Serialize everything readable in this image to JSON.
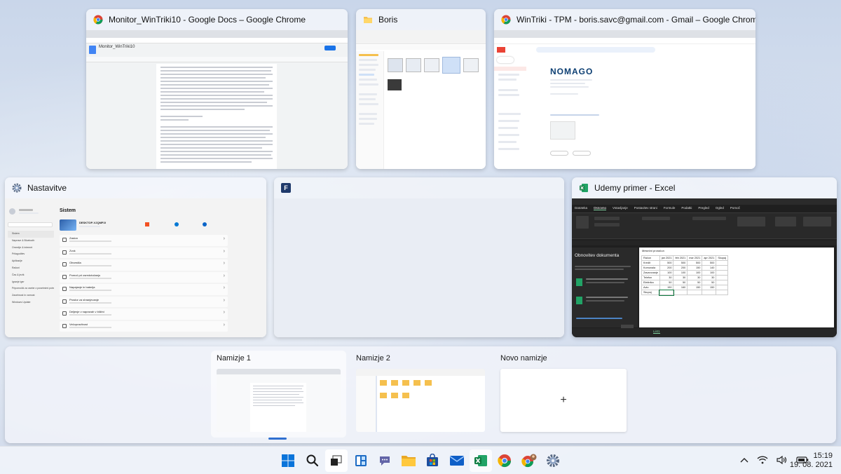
{
  "windows": {
    "docs": {
      "title": "Monitor_WinTriki10 - Google Docs – Google Chrome",
      "doc_title": "Monitor_WinTriki10",
      "icon": "chrome-icon"
    },
    "explorer": {
      "title": "Boris",
      "icon": "folder-icon"
    },
    "gmail": {
      "title": "WinTriki - TPM - boris.savc@gmail.com - Gmail – Google Chrome",
      "brand": "NOMAGO",
      "icon": "chrome-icon"
    },
    "settings": {
      "title": "Nastavitve",
      "section": "Sistem",
      "device": "DESKTOP-VJQMP2I",
      "nav": [
        "Sistem",
        "Naprave & Bluetooth",
        "Omrežje & internet",
        "Prilagoditev",
        "Aplikacije",
        "Računi",
        "Čas & jezik",
        "Igranje iger",
        "Pripomočki za osebe z posebnimi potrebami",
        "Zasebnost in varnost",
        "Windows Update"
      ],
      "rows": [
        "Zaslon",
        "Zvok",
        "Obvestila",
        "Pomoč pri osredotočanju",
        "Napajanje in baterija",
        "Prostor za shranjevanje",
        "Deljenje v napravah v bližini",
        "Večopravilnost"
      ],
      "icon": "gear-icon"
    },
    "blank": {
      "title": "",
      "icon": "app-f-icon"
    },
    "excel": {
      "title": "Udemy primer - Excel",
      "icon": "excel-icon",
      "menu": [
        "Datoteka",
        "Osnovno",
        "Vstavljanje",
        "Postavitev strani",
        "Formule",
        "Podatki",
        "Pregled",
        "Ogled",
        "Pomoč"
      ],
      "recovery_title": "Obnovitev dokumenta",
      "sheet_title": "Mesečni proračun",
      "columns": [
        "Račun",
        "jan 2021",
        "feb 2021",
        "mar 2021",
        "apr 2021",
        "Skupaj"
      ],
      "rows": [
        [
          "Kredit",
          "500",
          "500",
          "500",
          "500",
          ""
        ],
        [
          "Komunala",
          "200",
          "200",
          "150",
          "140",
          ""
        ],
        [
          "Zavarovanje",
          "100",
          "100",
          "100",
          "100",
          ""
        ],
        [
          "Telefon",
          "30",
          "30",
          "30",
          "30",
          ""
        ],
        [
          "Elektrika",
          "50",
          "50",
          "50",
          "50",
          ""
        ],
        [
          "Avto",
          "150",
          "160",
          "150",
          "150",
          ""
        ],
        [
          "Skupaj",
          "",
          "",
          "",
          "",
          ""
        ]
      ],
      "sheet_tab": "List1"
    }
  },
  "desktops": [
    {
      "label": "Namizje 1"
    },
    {
      "label": "Namizje 2"
    },
    {
      "label": "Novo namizje",
      "plus": "+"
    }
  ],
  "taskbar": {
    "icons": [
      "windows-start-icon",
      "search-icon",
      "task-view-icon",
      "widgets-icon",
      "chat-icon",
      "file-explorer-icon",
      "store-icon",
      "mail-icon",
      "excel-icon",
      "chrome-icon",
      "chrome-profile-icon",
      "settings-icon"
    ],
    "time": "15:19",
    "date": "19. 08. 2021"
  }
}
